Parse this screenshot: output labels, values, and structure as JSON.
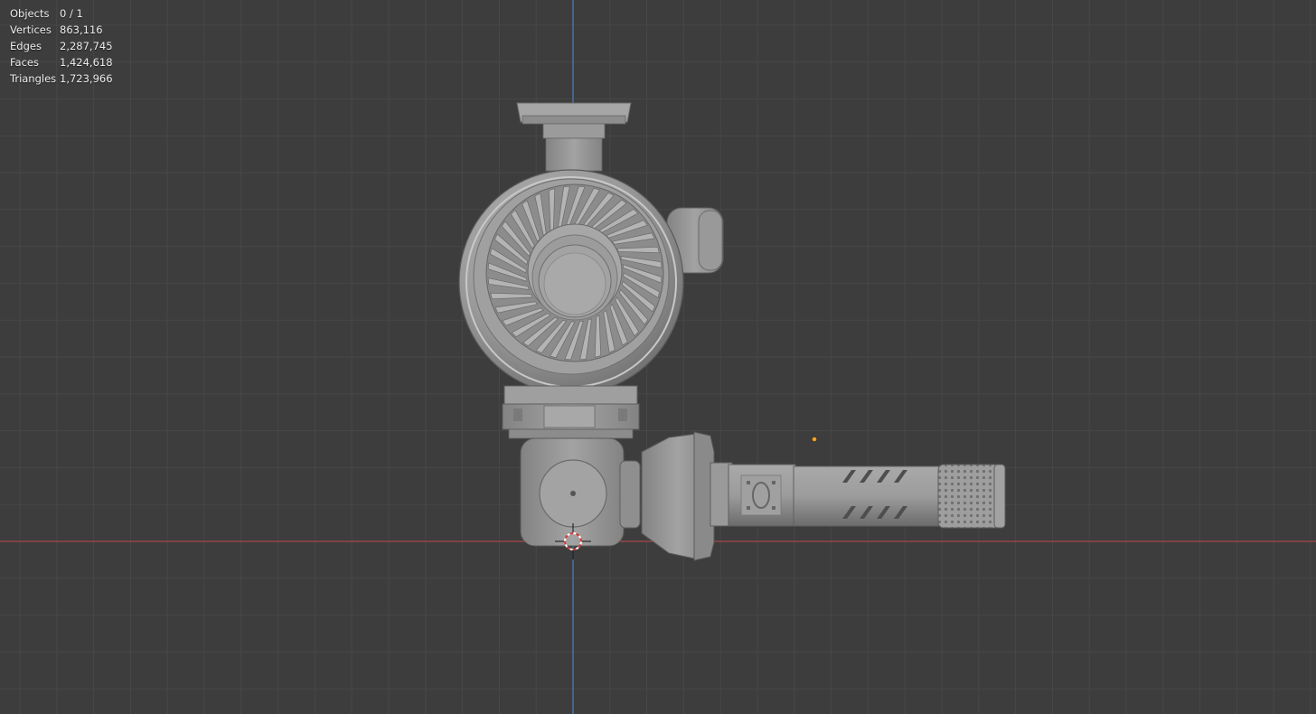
{
  "viewport": {
    "background_color": "#3d3d3d",
    "grid_color": "#474747",
    "x_axis_color": "#a8454c",
    "y_axis_color": "#4f7fbd",
    "light_color": "#ffa31a"
  },
  "stats": [
    {
      "label": "Objects",
      "value": "0 / 1"
    },
    {
      "label": "Vertices",
      "value": "863,116"
    },
    {
      "label": "Edges",
      "value": "2,287,745"
    },
    {
      "label": "Faces",
      "value": "1,424,618"
    },
    {
      "label": "Triangles",
      "value": "1,723,966"
    }
  ],
  "scene": {
    "model_color": "#9a9a9a",
    "model_shadow_color": "#6e6e6e",
    "model_highlight_color": "#bdbdbd"
  }
}
